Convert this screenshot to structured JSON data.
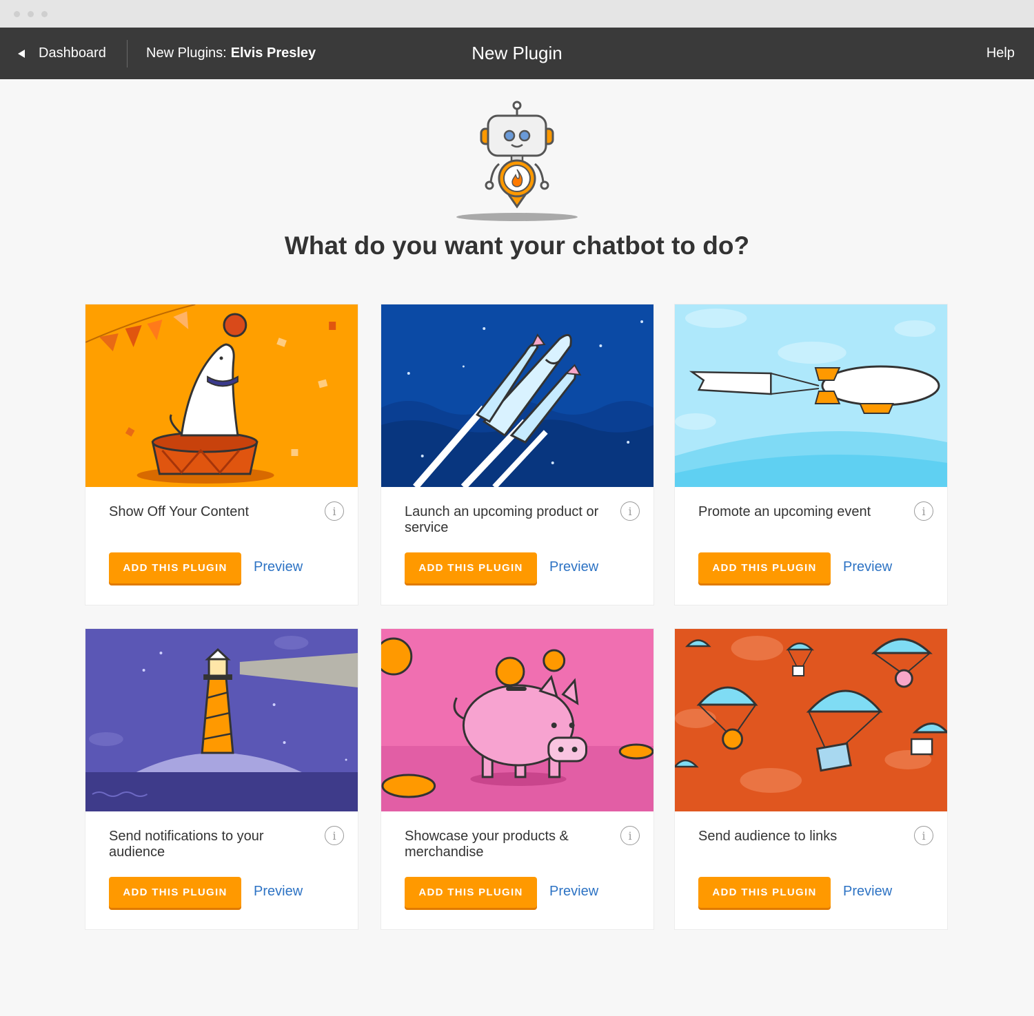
{
  "header": {
    "back_label": "Dashboard",
    "breadcrumb_prefix": "New Plugins:",
    "breadcrumb_name": "Elvis Presley",
    "title": "New Plugin",
    "help_label": "Help"
  },
  "main": {
    "question": "What do you want your chatbot to do?"
  },
  "cards": [
    {
      "title": "Show Off Your Content",
      "art": "seal-ball-illustration",
      "add_label": "ADD THIS PLUGIN",
      "preview_label": "Preview",
      "info_symbol": "i",
      "bg": "#ff9f00"
    },
    {
      "title": "Launch an upcoming product or service",
      "art": "rocket-illustration",
      "add_label": "ADD THIS PLUGIN",
      "preview_label": "Preview",
      "info_symbol": "i",
      "bg": "#0b4aa5"
    },
    {
      "title": "Promote an upcoming event",
      "art": "blimp-banner-illustration",
      "add_label": "ADD THIS PLUGIN",
      "preview_label": "Preview",
      "info_symbol": "i",
      "bg": "#aee8fb"
    },
    {
      "title": "Send notifications to your audience",
      "art": "lighthouse-illustration",
      "add_label": "ADD THIS PLUGIN",
      "preview_label": "Preview",
      "info_symbol": "i",
      "bg": "#5b57b5"
    },
    {
      "title": "Showcase your products & merchandise",
      "art": "piggy-bank-illustration",
      "add_label": "ADD THIS PLUGIN",
      "preview_label": "Preview",
      "info_symbol": "i",
      "bg": "#f06fb1"
    },
    {
      "title": "Send audience to links",
      "art": "parachutes-illustration",
      "add_label": "ADD THIS PLUGIN",
      "preview_label": "Preview",
      "info_symbol": "i",
      "bg": "#e0561f"
    }
  ],
  "colors": {
    "accent": "#ff9900",
    "link": "#2d73c4",
    "topbar": "#3a3a3a",
    "page_bg": "#f7f7f7"
  }
}
